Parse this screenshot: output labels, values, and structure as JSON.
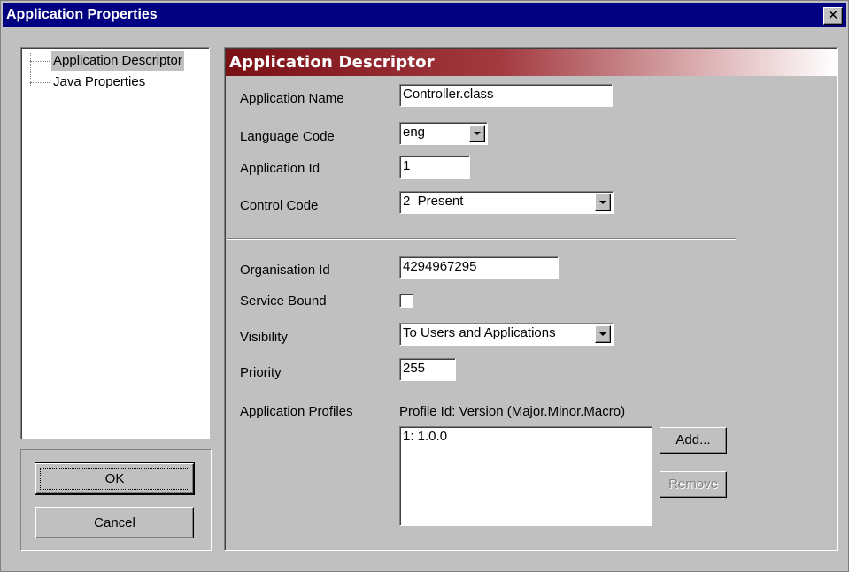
{
  "window": {
    "title": "Application Properties",
    "close_glyph": "✕"
  },
  "tree": {
    "items": [
      {
        "label": "Application Descriptor",
        "selected": true
      },
      {
        "label": "Java Properties",
        "selected": false
      }
    ]
  },
  "buttons": {
    "ok": "OK",
    "cancel": "Cancel",
    "add": "Add...",
    "remove": "Remove"
  },
  "header": {
    "title": "Application Descriptor",
    "accent_color": "#7a0f14"
  },
  "fields": {
    "application_name": {
      "label": "Application Name",
      "value": "Controller.class"
    },
    "language_code": {
      "label": "Language Code",
      "value": "eng"
    },
    "application_id": {
      "label": "Application Id",
      "value": "1"
    },
    "control_code": {
      "label": "Control Code",
      "value": "2  Present"
    },
    "organisation_id": {
      "label": "Organisation Id",
      "value": "4294967295"
    },
    "service_bound": {
      "label": "Service Bound",
      "checked": false
    },
    "visibility": {
      "label": "Visibility",
      "value": "To Users and Applications"
    },
    "priority": {
      "label": "Priority",
      "value": "255"
    },
    "application_profiles": {
      "label": "Application Profiles",
      "column_header": "Profile Id: Version (Major.Minor.Macro)",
      "items": [
        "1: 1.0.0"
      ]
    }
  }
}
